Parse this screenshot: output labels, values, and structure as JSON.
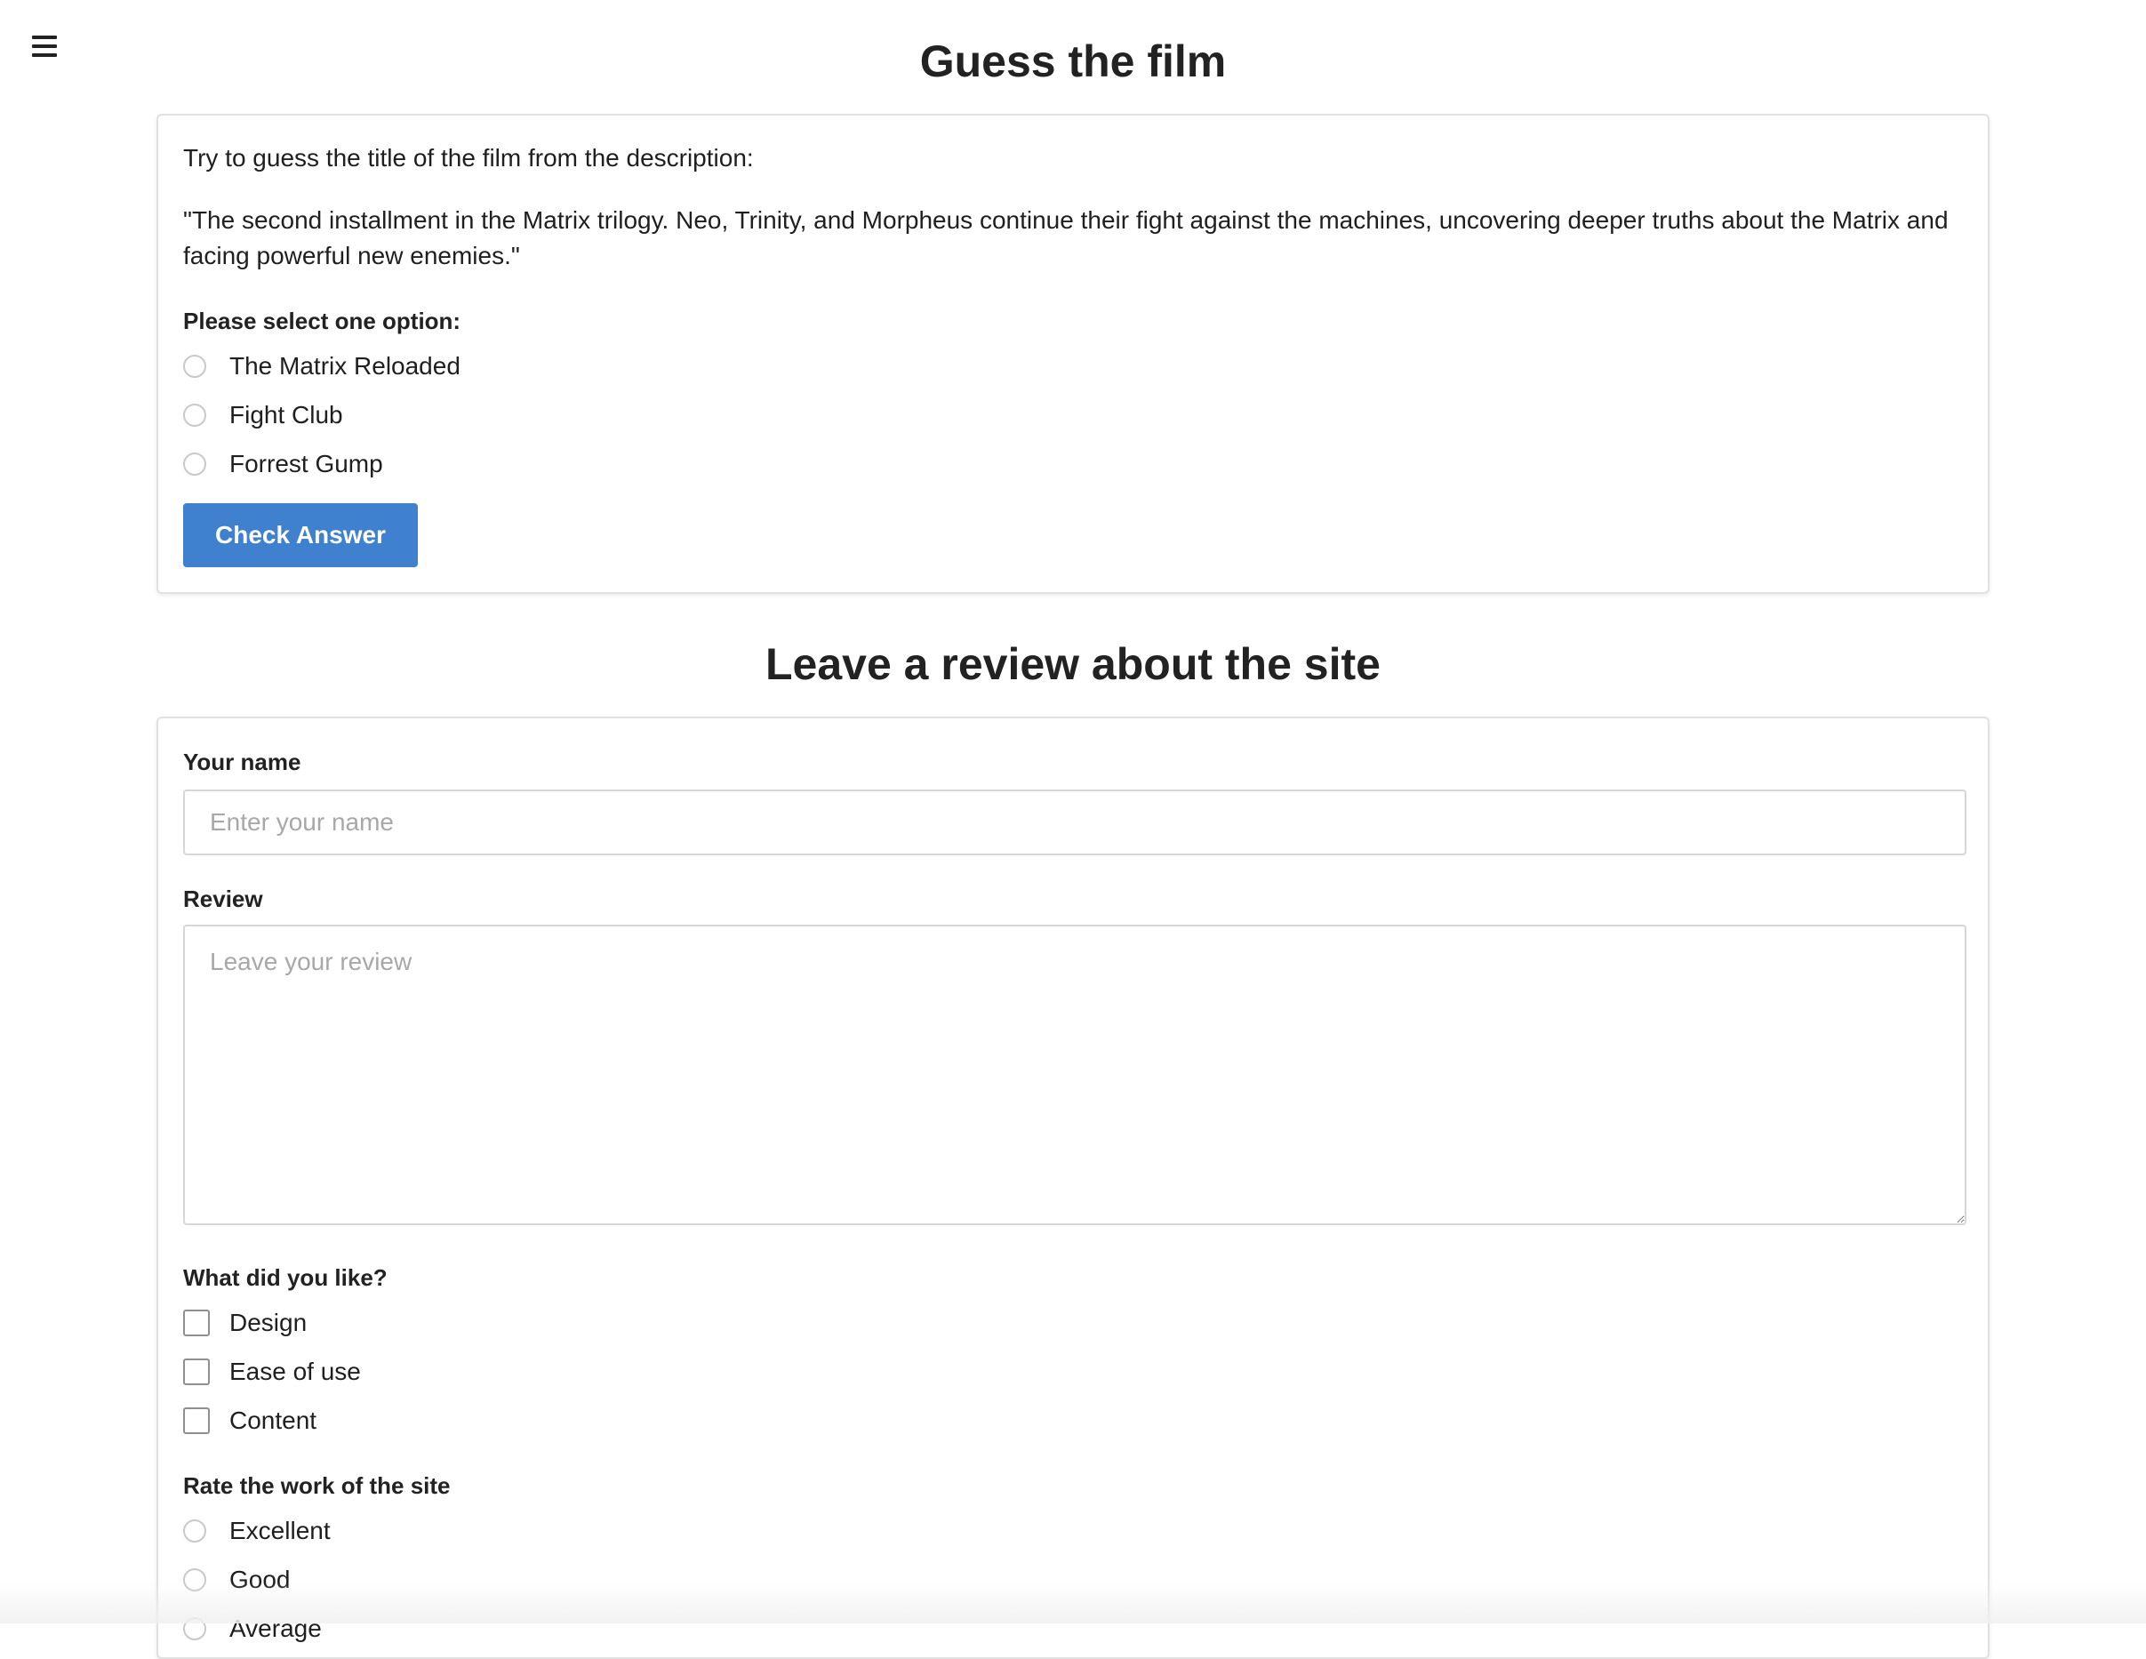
{
  "menu": {
    "icon": "hamburger-menu-icon"
  },
  "quiz": {
    "title": "Guess the film",
    "intro": "Try to guess the title of the film from the description:",
    "description": "\"The second installment in the Matrix trilogy. Neo, Trinity, and Morpheus continue their fight against the machines, uncovering deeper truths about the Matrix and facing powerful new enemies.\"",
    "select_label": "Please select one option:",
    "options": [
      {
        "label": "The Matrix Reloaded",
        "selected": false
      },
      {
        "label": "Fight Club",
        "selected": false
      },
      {
        "label": "Forrest Gump",
        "selected": false
      }
    ],
    "check_button": "Check Answer"
  },
  "review": {
    "title": "Leave a review about the site",
    "name_label": "Your name",
    "name_placeholder": "Enter your name",
    "name_value": "",
    "review_label": "Review",
    "review_placeholder": "Leave your review",
    "review_value": "",
    "liked_label": "What did you like?",
    "liked_options": [
      {
        "label": "Design",
        "checked": false
      },
      {
        "label": "Ease of use",
        "checked": false
      },
      {
        "label": "Content",
        "checked": false
      }
    ],
    "rate_label": "Rate the work of the site",
    "rate_options": [
      {
        "label": "Excellent",
        "selected": false
      },
      {
        "label": "Good",
        "selected": false
      },
      {
        "label": "Average",
        "selected": false
      }
    ]
  },
  "colors": {
    "primary_button": "#3f80cf",
    "card_border": "#e1e1e1",
    "text": "#1f1f1f",
    "placeholder": "#a8a8a8"
  }
}
